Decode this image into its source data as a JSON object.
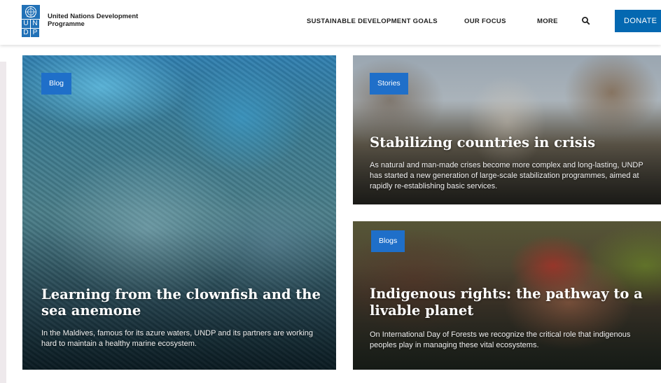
{
  "header": {
    "logo": {
      "icon": "un-emblem-icon",
      "letters": [
        "U",
        "N",
        "D",
        "P"
      ],
      "color": "#2171b7"
    },
    "brand_line1": "United Nations Development",
    "brand_line2": "Programme",
    "nav": [
      {
        "label": "SUSTAINABLE DEVELOPMENT GOALS"
      },
      {
        "label": "OUR FOCUS"
      },
      {
        "label": "MORE"
      }
    ],
    "search_icon": "search-icon",
    "donate_label": "DONATE",
    "donate_color": "#0468b1"
  },
  "cards": [
    {
      "tag": "Blog",
      "title": "Learning from the clownfish and the sea anemone",
      "description": "In the Maldives, famous for its azure waters, UNDP and its partners are working hard to maintain a healthy marine ecosystem."
    },
    {
      "tag": "Stories",
      "title": "Stabilizing countries in crisis",
      "description": "As natural and man-made crises become more complex and long-lasting, UNDP has started a new generation of large-scale stabilization programmes, aimed at rapidly re-establishing basic services."
    },
    {
      "tag": "Blogs",
      "title": "Indigenous rights: the pathway to a livable planet",
      "description": "On International Day of Forests we recognize the critical role that indigenous peoples play in managing these vital ecosystems."
    }
  ],
  "colors": {
    "tag": "#1f6fc9"
  }
}
